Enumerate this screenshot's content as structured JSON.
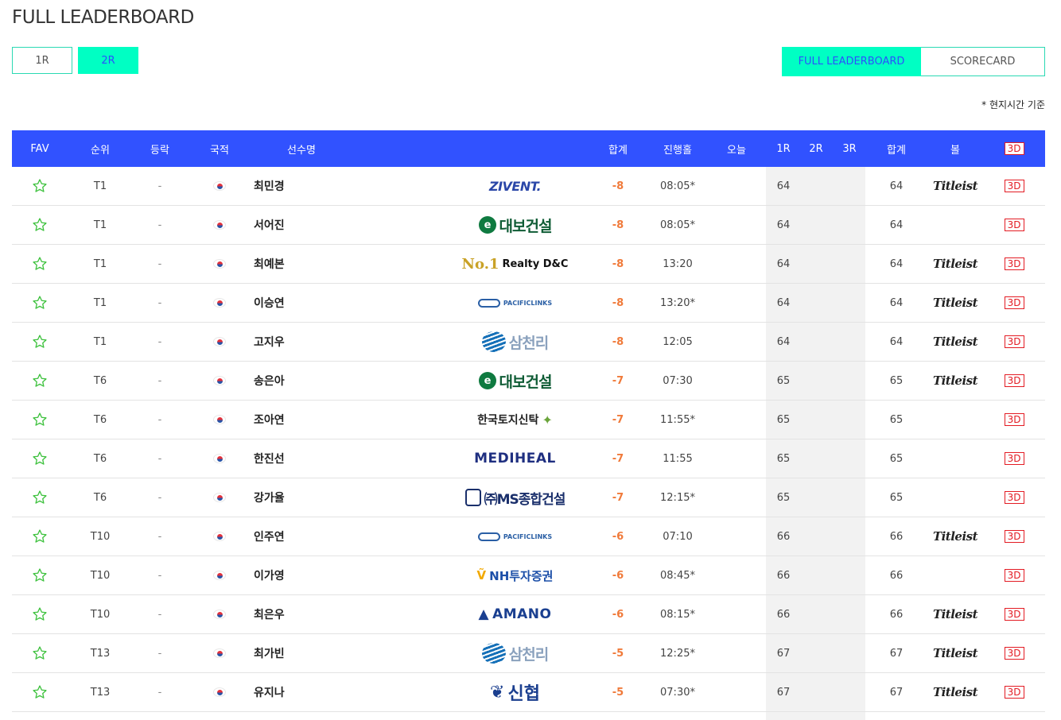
{
  "page": {
    "title": "FULL LEADERBOARD",
    "timezone_note": "* 현지시간 기준"
  },
  "round_tabs": [
    {
      "label": "1R",
      "active": false
    },
    {
      "label": "2R",
      "active": true
    }
  ],
  "view_tabs": [
    {
      "label": "FULL LEADERBOARD",
      "active": true
    },
    {
      "label": "SCORECARD",
      "active": false
    }
  ],
  "colors": {
    "accent": "#00ffc3",
    "header_bg": "#3152ff",
    "score": "#f07a3a",
    "badge": "#e31b23"
  },
  "table": {
    "headers": {
      "fav": "FAV",
      "rank": "순위",
      "move": "등락",
      "nation": "국적",
      "player": "선수명",
      "total": "합계",
      "hole": "진행홀",
      "today": "오늘",
      "r1": "1R",
      "r2": "2R",
      "r3": "3R",
      "sum": "합계",
      "ball": "볼",
      "view3d": "3D"
    },
    "rows": [
      {
        "rank": "T1",
        "move": "-",
        "name": "최민경",
        "sponsor": "ZIVENT.",
        "sponsor_type": "zivent",
        "total": "-8",
        "hole": "08:05*",
        "r1": "64",
        "sum": "64",
        "ball": "Titleist",
        "view3d": "3D"
      },
      {
        "rank": "T1",
        "move": "-",
        "name": "서어진",
        "sponsor": "대보건설",
        "sponsor_type": "daebo",
        "total": "-8",
        "hole": "08:05*",
        "r1": "64",
        "sum": "64",
        "ball": "",
        "view3d": "3D"
      },
      {
        "rank": "T1",
        "move": "-",
        "name": "최예본",
        "sponsor": "Realty D&C",
        "sponsor_type": "no1",
        "total": "-8",
        "hole": "13:20",
        "r1": "64",
        "sum": "64",
        "ball": "Titleist",
        "view3d": "3D"
      },
      {
        "rank": "T1",
        "move": "-",
        "name": "이승연",
        "sponsor": "PACIFICLINKS",
        "sponsor_type": "pacific",
        "total": "-8",
        "hole": "13:20*",
        "r1": "64",
        "sum": "64",
        "ball": "Titleist",
        "view3d": "3D"
      },
      {
        "rank": "T1",
        "move": "-",
        "name": "고지우",
        "sponsor": "삼천리",
        "sponsor_type": "samch",
        "total": "-8",
        "hole": "12:05",
        "r1": "64",
        "sum": "64",
        "ball": "Titleist",
        "view3d": "3D"
      },
      {
        "rank": "T6",
        "move": "-",
        "name": "송은아",
        "sponsor": "대보건설",
        "sponsor_type": "daebo",
        "total": "-7",
        "hole": "07:30",
        "r1": "65",
        "sum": "65",
        "ball": "Titleist",
        "view3d": "3D"
      },
      {
        "rank": "T6",
        "move": "-",
        "name": "조아연",
        "sponsor": "한국토지신탁",
        "sponsor_type": "landt",
        "total": "-7",
        "hole": "11:55*",
        "r1": "65",
        "sum": "65",
        "ball": "",
        "view3d": "3D"
      },
      {
        "rank": "T6",
        "move": "-",
        "name": "한진선",
        "sponsor": "MEDIHEAL",
        "sponsor_type": "medi",
        "total": "-7",
        "hole": "11:55",
        "r1": "65",
        "sum": "65",
        "ball": "",
        "view3d": "3D"
      },
      {
        "rank": "T6",
        "move": "-",
        "name": "강가율",
        "sponsor": "㈜MS종합건설",
        "sponsor_type": "ms",
        "total": "-7",
        "hole": "12:15*",
        "r1": "65",
        "sum": "65",
        "ball": "",
        "view3d": "3D"
      },
      {
        "rank": "T10",
        "move": "-",
        "name": "인주연",
        "sponsor": "PACIFICLINKS",
        "sponsor_type": "pacific",
        "total": "-6",
        "hole": "07:10",
        "r1": "66",
        "sum": "66",
        "ball": "Titleist",
        "view3d": "3D"
      },
      {
        "rank": "T10",
        "move": "-",
        "name": "이가영",
        "sponsor": "NH투자증권",
        "sponsor_type": "nh",
        "total": "-6",
        "hole": "08:45*",
        "r1": "66",
        "sum": "66",
        "ball": "",
        "view3d": "3D"
      },
      {
        "rank": "T10",
        "move": "-",
        "name": "최은우",
        "sponsor": "AMANO",
        "sponsor_type": "amano",
        "total": "-6",
        "hole": "08:15*",
        "r1": "66",
        "sum": "66",
        "ball": "Titleist",
        "view3d": "3D"
      },
      {
        "rank": "T13",
        "move": "-",
        "name": "최가빈",
        "sponsor": "삼천리",
        "sponsor_type": "samch",
        "total": "-5",
        "hole": "12:25*",
        "r1": "67",
        "sum": "67",
        "ball": "Titleist",
        "view3d": "3D"
      },
      {
        "rank": "T13",
        "move": "-",
        "name": "유지나",
        "sponsor": "신협",
        "sponsor_type": "shin",
        "total": "-5",
        "hole": "07:30*",
        "r1": "67",
        "sum": "67",
        "ball": "Titleist",
        "view3d": "3D"
      }
    ]
  }
}
